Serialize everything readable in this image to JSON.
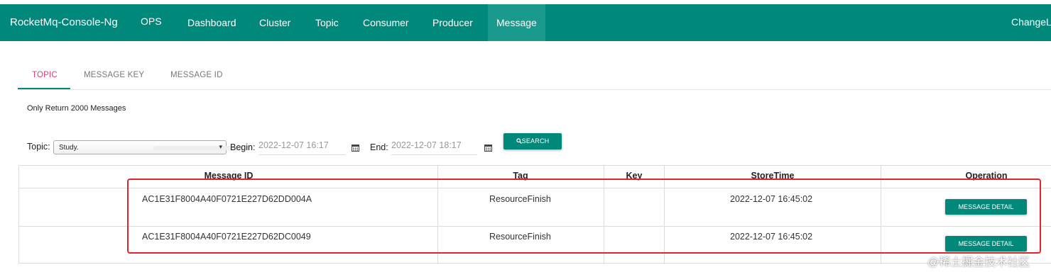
{
  "app": {
    "brand": "RocketMq-Console-Ng",
    "nav": [
      "OPS",
      "Dashboard",
      "Cluster",
      "Topic",
      "Consumer",
      "Producer",
      "Message"
    ],
    "active_nav": "Message",
    "change_lang": "ChangeLa"
  },
  "tabs": [
    "TOPIC",
    "MESSAGE KEY",
    "MESSAGE ID"
  ],
  "active_tab": "TOPIC",
  "note": "Only Return 2000 Messages",
  "search": {
    "topic_label": "Topic:",
    "topic_value": "Study.",
    "begin_label": "Begin:",
    "begin_value": "2022-12-07 16:17",
    "end_label": "End:",
    "end_value": "2022-12-07 18:17",
    "button": "SEARCH"
  },
  "table": {
    "headers": [
      "Message ID",
      "Tag",
      "Key",
      "StoreTime",
      "Operation"
    ],
    "rows": [
      {
        "message_id": "AC1E31F8004A40F0721E227D62DD004A",
        "tag": "ResourceFinish",
        "key": "",
        "store_time": "2022-12-07 16:45:02",
        "operation": "MESSAGE DETAIL"
      },
      {
        "message_id": "AC1E31F8004A40F0721E227D62DC0049",
        "tag": "ResourceFinish",
        "key": "",
        "store_time": "2022-12-07 16:45:02",
        "operation": "MESSAGE DETAIL"
      }
    ]
  },
  "colors": {
    "primary": "#00897b",
    "active_tab": "#e53b6f",
    "highlight": "#e0262b"
  },
  "watermark": "@稀土掘金技术社区"
}
